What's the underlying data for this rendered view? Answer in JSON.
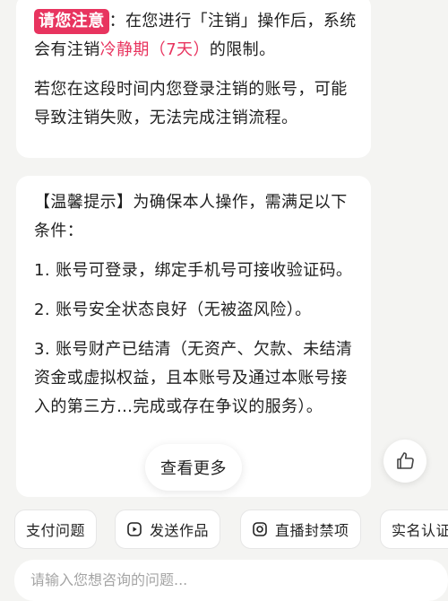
{
  "notice": {
    "badge": "请您注意",
    "line1_after_badge": "：在您进行「注销」操作后，",
    "line2_prefix": "系统会有注销",
    "line2_highlight": "冷静期（7天）",
    "line2_suffix": "的限制。",
    "paragraph2": "若您在这段时间内您登录注销的账号，可能导致注销失败，无法完成注销流程。"
  },
  "tips": {
    "intro": "【温馨提示】为确保本人操作，需满足以下条件：",
    "items": [
      "1. 账号可登录，绑定手机号可接收验证码。",
      "2. 账号安全状态良好（无被盗风险）。",
      "3. 账号财产已结清（无资产、欠款、未结清资金或虚拟权益，且本账号及通过本账号接入的第三方…完成或存在争议的服务）。"
    ]
  },
  "more_button": "查看更多",
  "quick_chips": [
    {
      "label": "支付问题",
      "icon": ""
    },
    {
      "label": "发送作品",
      "icon": "video-send-icon"
    },
    {
      "label": "直播封禁项",
      "icon": "live-ban-icon"
    },
    {
      "label": "实名认证",
      "icon": ""
    }
  ],
  "input": {
    "placeholder": "请输入您想咨询的问题..."
  },
  "colors": {
    "accent": "#e8345f",
    "background": "#f4f4f2"
  }
}
